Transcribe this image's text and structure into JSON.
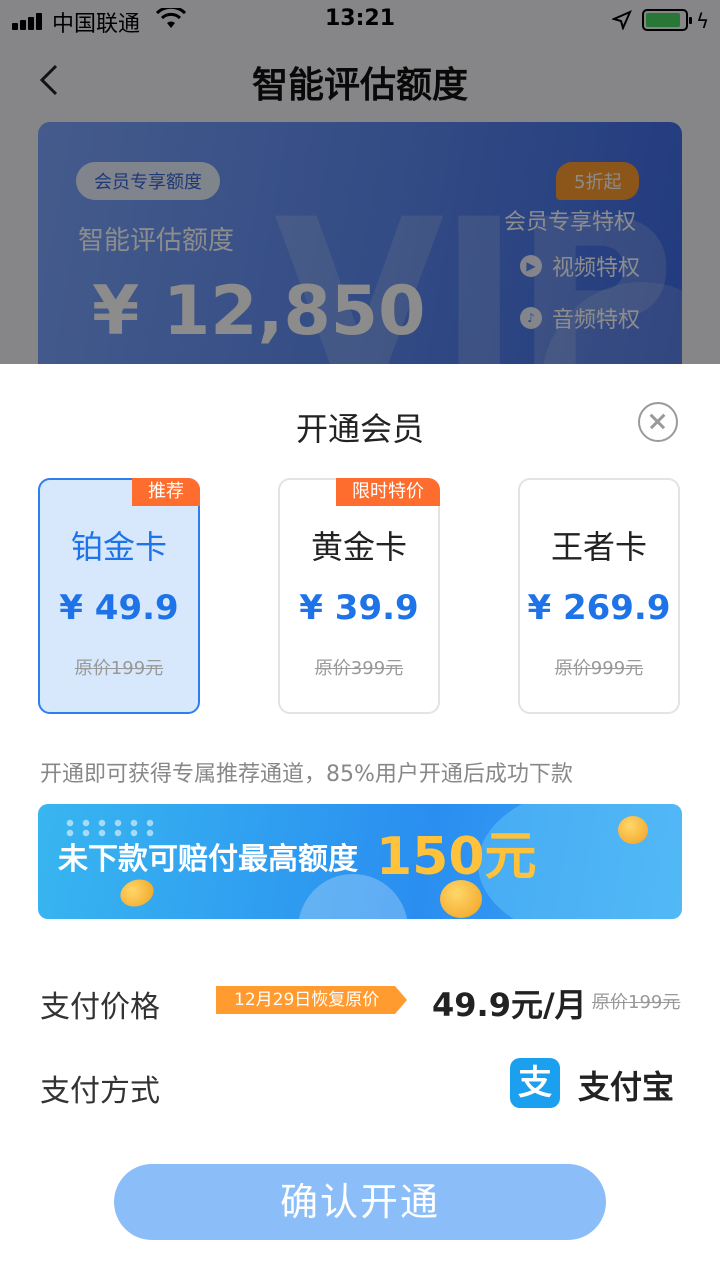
{
  "status_bar": {
    "carrier": "中国联通",
    "time": "13:21"
  },
  "nav": {
    "title": "智能评估额度"
  },
  "quota_card": {
    "tag": "会员专享额度",
    "label": "智能评估额度",
    "amount": "¥ 12,850",
    "watermark": "VIP",
    "discount_badge": "5折起",
    "privileges_title": "会员专享特权",
    "privileges": [
      "视频特权",
      "音频特权"
    ]
  },
  "sheet": {
    "title": "开通会员",
    "plans": [
      {
        "badge": "推荐",
        "name": "铂金卡",
        "price": "¥ 49.9",
        "original": "原价199元",
        "selected": true
      },
      {
        "badge": "限时特价",
        "name": "黄金卡",
        "price": "¥ 39.9",
        "original": "原价399元",
        "selected": false
      },
      {
        "badge": "",
        "name": "王者卡",
        "price": "¥ 269.9",
        "original": "原价999元",
        "selected": false
      }
    ],
    "hint": "开通即可获得专属推荐通道，85%用户开通后成功下款",
    "banner": {
      "text": "未下款可赔付最高额度",
      "amount": "150元"
    },
    "payment_price": {
      "label": "支付价格",
      "restore_note": "12月29日恢复原价",
      "price": "49.9元/月",
      "original": "原价199元"
    },
    "payment_method": {
      "label": "支付方式",
      "icon_glyph": "支",
      "name": "支付宝"
    },
    "confirm_button": "确认开通"
  },
  "colors": {
    "accent": "#1f73e8",
    "badge": "#ff6d2e",
    "restore_tag": "#ff9b2f",
    "banner_amount": "#ffc23a",
    "confirm_button": "#8bbdf8",
    "alipay": "#1aa0ee"
  }
}
